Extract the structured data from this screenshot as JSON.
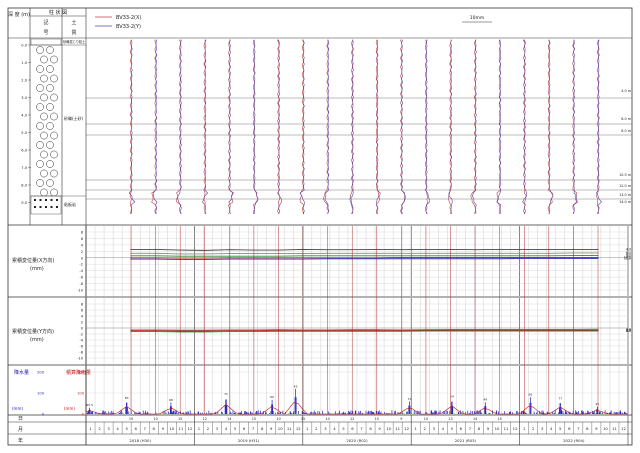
{
  "header": {
    "col_depth": "深\n度\n(m)",
    "col_column": "柱\n状",
    "col_soil": "土\n質",
    "col_top": "柱 状 図",
    "col_symbol_a": "記",
    "col_symbol_b": "号",
    "col_name_a": "土",
    "col_name_b": "質"
  },
  "legend": {
    "items": [
      {
        "label": "BV33-2(X)",
        "color": "#c04040"
      },
      {
        "label": "BV33-2(Y)",
        "color": "#6040a0"
      }
    ],
    "scale_label": "10mm"
  },
  "soil_layers": [
    {
      "label": "砂礫混じり粘土",
      "from": 0,
      "to": 1
    },
    {
      "label": "砂礫(土砂)",
      "from": 1,
      "to": 13
    },
    {
      "label": "粘板岩",
      "from": 13,
      "to": 16
    }
  ],
  "depth_ticks": [
    "0.0",
    "1.0",
    "2.0",
    "3.0",
    "4.0",
    "5.0",
    "6.0",
    "7.0",
    "8.0",
    "9.0"
  ],
  "right_depth_labels": [
    "4.0 m",
    "6.0 m",
    "8.0 m",
    "10.5 m",
    "12.0 m",
    "13.0 m",
    "14.0 m"
  ],
  "panel_x": {
    "title": "累積変位量(X方向)",
    "unit": "(mm)",
    "y_ticks": [
      "8",
      "6",
      "4",
      "2",
      "0",
      "-2",
      "-4",
      "-6",
      "-8",
      "-10"
    ],
    "right_labels": [
      "4.0",
      "6.0",
      "8.0",
      "10.5",
      "12.0"
    ]
  },
  "panel_y": {
    "title": "累積変位量(Y方向)",
    "unit": "(mm)",
    "y_ticks": [
      "8",
      "6",
      "4",
      "2",
      "0",
      "-2",
      "-4",
      "-6",
      "-8",
      "-10"
    ],
    "right_labels": [
      "4.0",
      "6.0",
      "8.0"
    ]
  },
  "rain": {
    "left_title": "降水量",
    "left_unit": "(mm)",
    "left_ticks": [
      "200",
      "100",
      "0"
    ],
    "right_title": "積算降雨量",
    "right_unit": "(mm)",
    "right_ticks": [
      "200",
      "100",
      "0"
    ],
    "peak_labels": [
      "65.5",
      "83",
      "68",
      "71",
      "60",
      "45",
      "71",
      "34",
      "49",
      "60",
      "77",
      "45",
      "48",
      "70",
      "75"
    ]
  },
  "time_axis": {
    "row_day": "日",
    "row_month": "月",
    "row_year": "年",
    "months": [
      "1",
      "2",
      "3",
      "4",
      "5",
      "6",
      "7",
      "8",
      "9",
      "10",
      "11",
      "12",
      "1",
      "2",
      "3",
      "4",
      "5",
      "6",
      "7",
      "8",
      "9",
      "10",
      "11",
      "12",
      "1",
      "2",
      "3",
      "4",
      "5",
      "6",
      "7",
      "8",
      "9",
      "10",
      "11",
      "12",
      "1",
      "2",
      "3",
      "4",
      "5",
      "6",
      "7",
      "8",
      "9",
      "10",
      "11",
      "12",
      "1",
      "2",
      "3",
      "4",
      "5",
      "6",
      "7",
      "8",
      "9",
      "10",
      "11",
      "12"
    ],
    "years": [
      "2018 (H30)",
      "2019 (H31)",
      "2020 (R02)",
      "2021 (R03)",
      "2022 (R04)"
    ],
    "day_marks": [
      "15",
      "10",
      "15",
      "12",
      "14",
      "15",
      "10",
      "15",
      "10",
      "12",
      "15",
      "9",
      "10",
      "13",
      "14",
      "15"
    ]
  },
  "chart_data": {
    "type": "line",
    "title": "",
    "measurement_count": 20,
    "x_range": [
      "2018-01",
      "2022-12"
    ],
    "x_axis": "month",
    "inclinometer_depth_range_m": [
      0,
      16
    ],
    "panel_x_ylim": [
      -10,
      8
    ],
    "panel_y_ylim": [
      -10,
      8
    ],
    "panel_x_series": [
      {
        "name": "4.0",
        "values": [
          2.6,
          2.6,
          2.4,
          2.3,
          2.5,
          2.4,
          2.4,
          2.6,
          2.5,
          2.5,
          2.6,
          2.5,
          2.6,
          2.6,
          2.5,
          2.6,
          2.6,
          2.6,
          2.6,
          2.6
        ],
        "color": "#444444"
      },
      {
        "name": "6.0",
        "values": [
          1.4,
          1.4,
          1.2,
          1.2,
          1.3,
          1.3,
          1.3,
          1.3,
          1.4,
          1.4,
          1.4,
          1.4,
          1.4,
          1.4,
          1.4,
          1.4,
          1.4,
          1.4,
          1.5,
          1.5
        ],
        "color": "#888888"
      },
      {
        "name": "8.0",
        "values": [
          0.6,
          0.6,
          0.5,
          0.5,
          0.5,
          0.5,
          0.5,
          0.6,
          0.6,
          0.6,
          0.6,
          0.6,
          0.6,
          0.6,
          0.6,
          0.6,
          0.6,
          0.6,
          0.7,
          0.7
        ],
        "color": "#2a8a2a"
      },
      {
        "name": "10.5",
        "values": [
          0,
          0,
          -0.1,
          -0.1,
          0,
          0,
          0,
          0,
          0,
          0,
          0,
          0.1,
          0.1,
          0.1,
          0.1,
          0.1,
          0.1,
          0.1,
          0.1,
          0.1
        ],
        "color": "#c02020"
      },
      {
        "name": "12.0",
        "values": [
          -0.4,
          -0.4,
          -0.5,
          -0.5,
          -0.4,
          -0.4,
          -0.4,
          -0.4,
          -0.3,
          -0.3,
          -0.3,
          -0.3,
          -0.3,
          -0.3,
          -0.3,
          -0.3,
          -0.2,
          -0.2,
          -0.2,
          -0.2
        ],
        "color": "#3030c0"
      }
    ],
    "panel_y_series": [
      {
        "name": "4.0",
        "values": [
          -0.6,
          -0.6,
          -0.7,
          -0.7,
          -0.6,
          -0.6,
          -0.5,
          -0.6,
          -0.6,
          -0.5,
          -0.5,
          -0.6,
          -0.5,
          -0.5,
          -0.5,
          -0.5,
          -0.5,
          -0.5,
          -0.5,
          -0.4
        ],
        "color": "#888888"
      },
      {
        "name": "6.0",
        "values": [
          -0.9,
          -0.9,
          -1.0,
          -1.0,
          -0.9,
          -0.9,
          -0.8,
          -0.8,
          -0.8,
          -0.8,
          -0.8,
          -0.8,
          -0.8,
          -0.7,
          -0.7,
          -0.7,
          -0.7,
          -0.7,
          -0.7,
          -0.7
        ],
        "color": "#c02020"
      },
      {
        "name": "8.0",
        "values": [
          -1.2,
          -1.2,
          -1.3,
          -1.3,
          -1.2,
          -1.2,
          -1.1,
          -1.1,
          -1.1,
          -1.1,
          -1.1,
          -1.1,
          -1.0,
          -1.0,
          -1.0,
          -1.0,
          -1.0,
          -1.0,
          -1.0,
          -1.0
        ],
        "color": "#2a8a2a"
      }
    ],
    "rain_ylim": [
      0,
      200
    ],
    "rain_peaks": [
      {
        "month_index": 0.4,
        "value": 30
      },
      {
        "month_index": 4.5,
        "value": 65
      },
      {
        "month_index": 9.4,
        "value": 55
      },
      {
        "month_index": 15.5,
        "value": 83
      },
      {
        "month_index": 20.6,
        "value": 68
      },
      {
        "month_index": 23.2,
        "value": 120
      },
      {
        "month_index": 35.8,
        "value": 60
      },
      {
        "month_index": 40.5,
        "value": 71
      },
      {
        "month_index": 44.2,
        "value": 56
      },
      {
        "month_index": 49.2,
        "value": 80
      },
      {
        "month_index": 52.5,
        "value": 62
      },
      {
        "month_index": 56.6,
        "value": 35
      }
    ]
  }
}
